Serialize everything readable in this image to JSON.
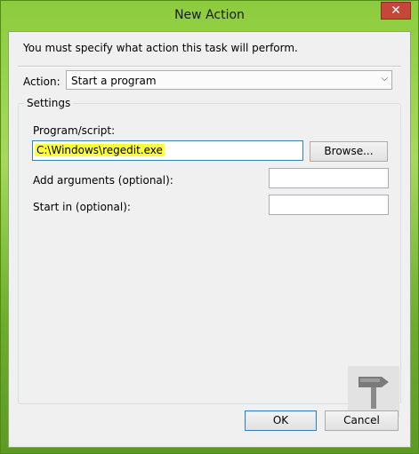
{
  "window": {
    "title": "New Action",
    "close_glyph": "✕"
  },
  "instruction": "You must specify what action this task will perform.",
  "action": {
    "label": "Action:",
    "selected": "Start a program",
    "dropdown_glyph": "⌵"
  },
  "settings": {
    "legend": "Settings",
    "program_label": "Program/script:",
    "program_value": "C:\\Windows\\regedit.exe",
    "browse_label": "Browse...",
    "arguments_label": "Add arguments (optional):",
    "arguments_value": "",
    "start_in_label": "Start in (optional):",
    "start_in_value": ""
  },
  "footer": {
    "ok_label": "OK",
    "cancel_label": "Cancel"
  },
  "colors": {
    "highlight": "#ffff33",
    "accent_border": "#3c7fb1"
  },
  "watermark_icon": "hammer-icon"
}
